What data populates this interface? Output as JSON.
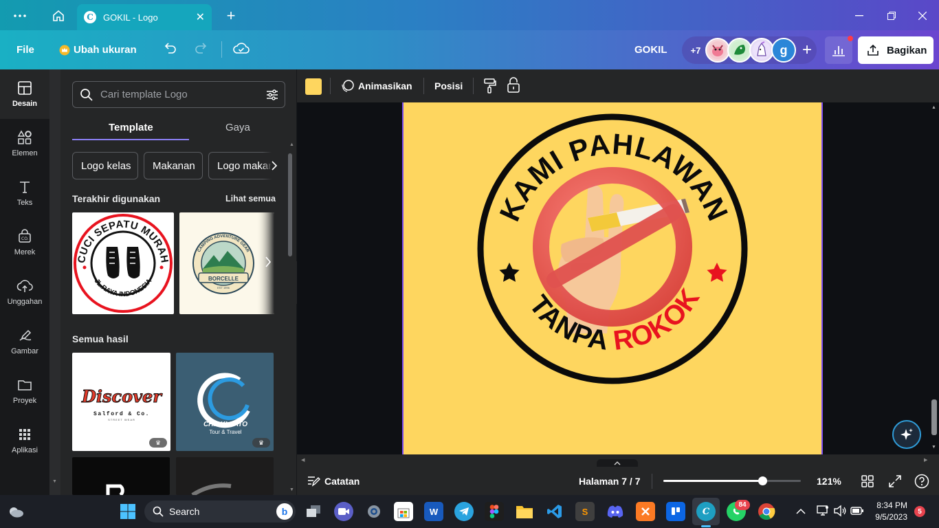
{
  "browser": {
    "tab_title": "GOKIL - Logo",
    "tab_favicon": "C"
  },
  "header": {
    "file_label": "File",
    "resize_label": "Ubah ukuran",
    "project_name": "GOKIL",
    "more_collaborators": "+7",
    "avatar_letter": "g",
    "share_label": "Bagikan",
    "gradient_start": "#1ab0c4",
    "gradient_end": "#6b45cf"
  },
  "rail": {
    "items": [
      {
        "label": "Desain",
        "icon": "layout-icon"
      },
      {
        "label": "Elemen",
        "icon": "shapes-icon"
      },
      {
        "label": "Teks",
        "icon": "text-icon"
      },
      {
        "label": "Merek",
        "icon": "brand-icon"
      },
      {
        "label": "Unggahan",
        "icon": "cloud-upload-icon"
      },
      {
        "label": "Gambar",
        "icon": "pen-icon"
      },
      {
        "label": "Proyek",
        "icon": "folder-icon"
      },
      {
        "label": "Aplikasi",
        "icon": "grid-icon"
      }
    ]
  },
  "panel": {
    "search_placeholder": "Cari template Logo",
    "tabs": [
      {
        "label": "Template",
        "active": true
      },
      {
        "label": "Gaya",
        "active": false
      }
    ],
    "chips": [
      "Logo kelas",
      "Makanan",
      "Logo makanan"
    ],
    "recent_title": "Terakhir digunakan",
    "see_all": "Lihat semua",
    "recent_items": [
      {
        "top": "CUCI SEPATU MURAH",
        "bottom": "JL.RAYA INDONESIA"
      },
      {
        "top": "CAMPING ADVENTURE GEAR",
        "name": "BORCELLE",
        "est": "EST 1996"
      }
    ],
    "results_title": "Semua hasil",
    "results": [
      {
        "title": "Discover",
        "sub": "Salford & Co.",
        "sub2": "STREET WEAR"
      },
      {
        "title": "CHIAKI SATO",
        "sub": "Tour & Travel"
      }
    ]
  },
  "toolbar": {
    "color_swatch": "#fed65f",
    "animate_label": "Animasikan",
    "position_label": "Posisi"
  },
  "design": {
    "top_text": "KAMI PAHLAWAN",
    "bottom_text_1": "TANPA",
    "bottom_text_2": "ROKOK",
    "background": "#fed65f",
    "accent_red": "#e8131f"
  },
  "footer": {
    "notes_label": "Catatan",
    "page_label": "Halaman 7 / 7",
    "zoom": "121%",
    "zoom_level": 0.72
  },
  "taskbar": {
    "search_label": "Search",
    "whatsapp_badge": "84",
    "time": "8:34 PM",
    "date": "9/5/2023",
    "notification_count": "5"
  }
}
